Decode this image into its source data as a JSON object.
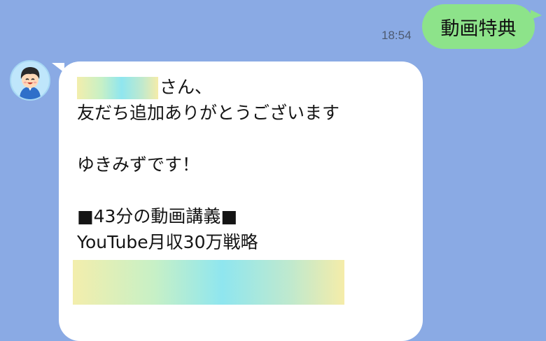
{
  "outgoing": {
    "time": "18:54",
    "text": "動画特典"
  },
  "incoming": {
    "name_suffix": "さん、",
    "line1": "友だち追加ありがとうございます",
    "line2": "ゆきみずです！",
    "line3": "■43分の動画講義■",
    "line4": "YouTube月収30万戦略"
  },
  "colors": {
    "background": "#8aaae4",
    "outgoing_bubble": "#8de38a",
    "incoming_bubble": "#ffffff"
  },
  "icons": {
    "avatar": "avatar-icon"
  }
}
